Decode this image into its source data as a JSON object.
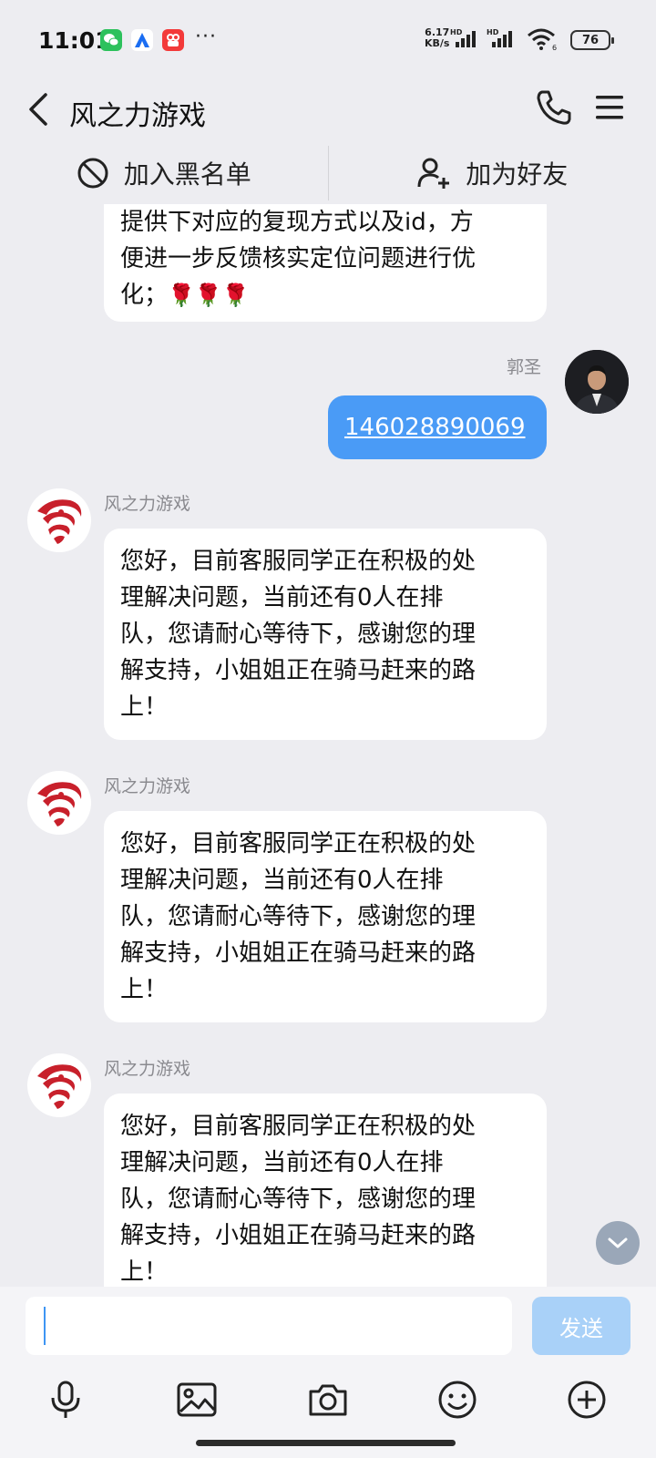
{
  "status_bar": {
    "time": "11:01",
    "more": "···",
    "net_speed": "6.17",
    "net_unit": "KB/s",
    "hd1": "HD",
    "hd2": "HD",
    "wifi_index": "6",
    "battery": "76",
    "app_icons": [
      "wechat-icon",
      "app-a-icon",
      "video-app-icon"
    ]
  },
  "header": {
    "title": "风之力游戏",
    "back_icon": "chevron-left-icon",
    "phone_icon": "phone-icon",
    "menu_icon": "menu-icon"
  },
  "actions": {
    "blacklist_label": "加入黑名单",
    "add_friend_label": "加为好友"
  },
  "messages": [
    {
      "type": "received-partial",
      "lines": [
        "提供下对应的复现方式以及id，方",
        "便进一步反馈核实定位问题进行优",
        "化；"
      ],
      "emoji": "🌹🌹🌹"
    },
    {
      "type": "sent",
      "sender": "郭圣",
      "text": "146028890069"
    },
    {
      "type": "received",
      "sender": "风之力游戏",
      "lines": [
        "您好，目前客服同学正在积极的处",
        "理解决问题，当前还有0人在排",
        "队，您请耐心等待下，感谢您的理",
        "解支持，小姐姐正在骑马赶来的路",
        "上！"
      ]
    },
    {
      "type": "received",
      "sender": "风之力游戏",
      "lines": [
        "您好，目前客服同学正在积极的处",
        "理解决问题，当前还有0人在排",
        "队，您请耐心等待下，感谢您的理",
        "解支持，小姐姐正在骑马赶来的路",
        "上！"
      ]
    },
    {
      "type": "received",
      "sender": "风之力游戏",
      "lines": [
        "您好，目前客服同学正在积极的处",
        "理解决问题，当前还有0人在排",
        "队，您请耐心等待下，感谢您的理",
        "解支持，小姐姐正在骑马赶来的路",
        "上！"
      ]
    }
  ],
  "composer": {
    "placeholder": "",
    "send_label": "发送"
  },
  "toolbar": [
    "microphone-icon",
    "image-icon",
    "camera-icon",
    "emoji-icon",
    "plus-icon"
  ],
  "colors": {
    "background": "#ededf1",
    "sent_bubble": "#4a9bf6",
    "send_button": "#a9d1f8",
    "logo_red": "#c8202b"
  }
}
